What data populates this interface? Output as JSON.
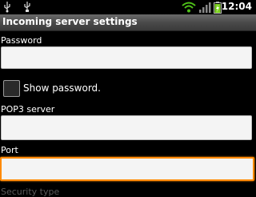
{
  "status_bar": {
    "time": "12:04",
    "icons": [
      "usb-icon",
      "usb-debug-icon",
      "wifi-icon",
      "signal-icon",
      "battery-charging-icon"
    ]
  },
  "title_bar": {
    "title": "Incoming server settings"
  },
  "form": {
    "password_label": "Password",
    "password_value": "",
    "show_password_label": "Show password.",
    "show_password_checked": false,
    "pop3_label": "POP3 server",
    "pop3_value": "",
    "port_label": "Port",
    "port_value": "",
    "security_type_label": "Security type"
  },
  "colors": {
    "focus": "#ff8a00",
    "wifi": "#4ec018",
    "battery": "#7ed321"
  }
}
